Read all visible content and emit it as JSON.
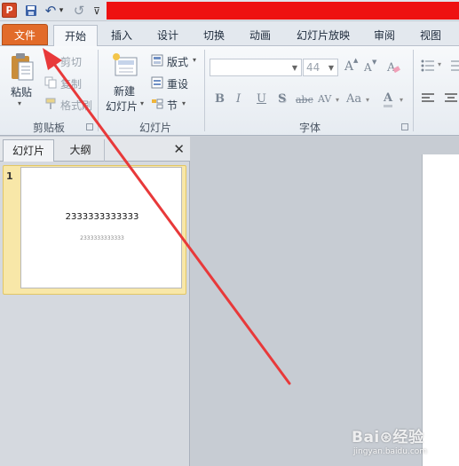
{
  "qat": {
    "logo_letter": "P",
    "save_glyph": "💾",
    "undo_glyph": "↶",
    "undo_menu_glyph": "▾",
    "redo_glyph": "↺",
    "customize_glyph": "⊽"
  },
  "tabs": {
    "file": "文件",
    "home": "开始",
    "insert": "插入",
    "design": "设计",
    "transitions": "切换",
    "animations": "动画",
    "slideshow": "幻灯片放映",
    "review": "审阅",
    "view": "视图"
  },
  "ribbon": {
    "clipboard": {
      "paste": "粘贴",
      "cut": "剪切",
      "copy": "复制",
      "format_painter": "格式刷",
      "group_label": "剪贴板"
    },
    "slides": {
      "new_slide_line1": "新建",
      "new_slide_line2": "幻灯片",
      "layout": "版式",
      "reset": "重设",
      "section": "节",
      "group_label": "幻灯片"
    },
    "font": {
      "font_name": "",
      "font_size": "44",
      "grow": "A",
      "shrink": "A",
      "bold": "B",
      "italic": "I",
      "underline": "U",
      "shadow": "S",
      "strike": "abc",
      "spacing": "AV",
      "case": "Aa",
      "color": "A",
      "group_label": "字体"
    }
  },
  "left_pane": {
    "tab_slides": "幻灯片",
    "tab_outline": "大纲",
    "close": "✕",
    "slide_number": "1",
    "thumb_title": "2333333333333",
    "thumb_subtitle": "2333333333333"
  },
  "watermark": {
    "brand": "Bai⊛经验",
    "url": "jingyan.baidu.com"
  },
  "colors": {
    "file_tab": "#e26b2a",
    "red_strip": "#ee1111",
    "arrow": "#e8393a",
    "thumb_highlight": "#f8e7a8"
  }
}
